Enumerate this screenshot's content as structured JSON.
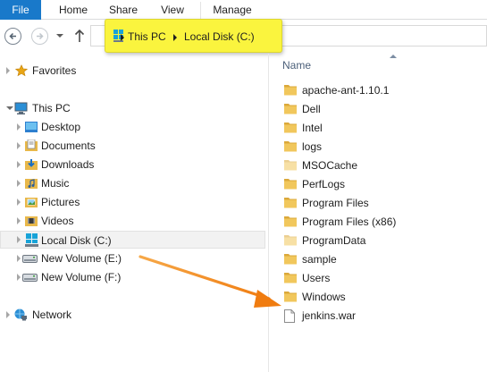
{
  "ribbon": {
    "tabs": [
      "File",
      "Home",
      "Share",
      "View",
      "Manage"
    ]
  },
  "address": {
    "crumbs": [
      "This PC",
      "Local Disk (C:)"
    ],
    "highlight_color": "#faf43e"
  },
  "nav_tree": {
    "favorites": "Favorites",
    "this_pc": "This PC",
    "children": [
      "Desktop",
      "Documents",
      "Downloads",
      "Music",
      "Pictures",
      "Videos",
      "Local Disk (C:)",
      "New Volume (E:)",
      "New Volume (F:)"
    ],
    "network": "Network"
  },
  "file_list": {
    "column_header": "Name",
    "items": [
      {
        "name": "apache-ant-1.10.1",
        "type": "folder"
      },
      {
        "name": "Dell",
        "type": "folder"
      },
      {
        "name": "Intel",
        "type": "folder"
      },
      {
        "name": "logs",
        "type": "folder"
      },
      {
        "name": "MSOCache",
        "type": "folder-hidden"
      },
      {
        "name": "PerfLogs",
        "type": "folder"
      },
      {
        "name": "Program Files",
        "type": "folder"
      },
      {
        "name": "Program Files (x86)",
        "type": "folder"
      },
      {
        "name": "ProgramData",
        "type": "folder-hidden"
      },
      {
        "name": "sample",
        "type": "folder"
      },
      {
        "name": "Users",
        "type": "folder"
      },
      {
        "name": "Windows",
        "type": "folder"
      },
      {
        "name": "jenkins.war",
        "type": "file"
      }
    ]
  },
  "colors": {
    "file_tab": "#1979ca",
    "folder": "#e8b84a",
    "arrow": "#f28a1c"
  }
}
